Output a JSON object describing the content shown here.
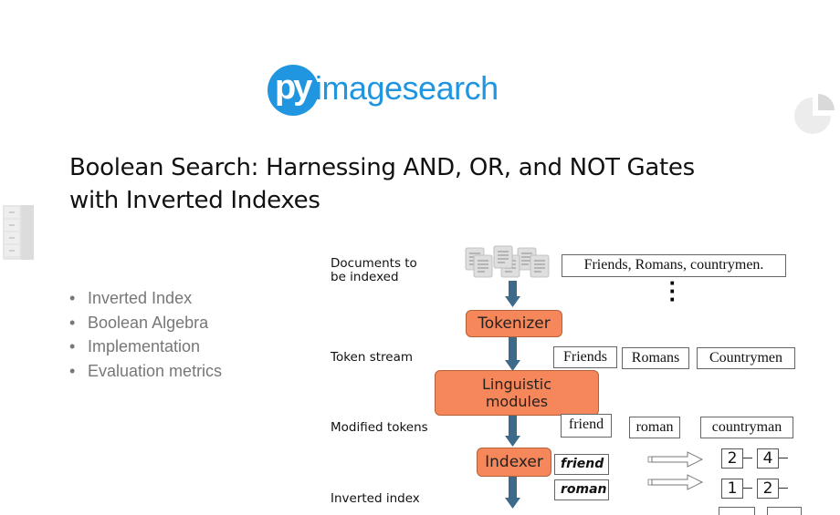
{
  "brand": {
    "logo_mark": "py",
    "logo_word": "imagesearch",
    "color": "#2196e0"
  },
  "icons": {
    "pie": "pie-chart-icon",
    "drawer": "file-cabinet-icon"
  },
  "title": {
    "line1": "Boolean Search: Harnessing AND, OR, and NOT Gates",
    "line2": "with Inverted Indexes"
  },
  "bullets": [
    "Inverted Index",
    "Boolean Algebra",
    "Implementation",
    "Evaluation metrics"
  ],
  "diagram": {
    "stage_labels": {
      "documents_line1": "Documents to",
      "documents_line2": "be indexed",
      "token_stream": "Token stream",
      "modified_tokens": "Modified tokens",
      "inverted_index": "Inverted index"
    },
    "modules": {
      "tokenizer": "Tokenizer",
      "linguistic_line1": "Linguistic",
      "linguistic_line2": "modules",
      "indexer": "Indexer"
    },
    "document_text": "Friends, Romans, countrymen.",
    "ellipsis": "⋮",
    "tokens": [
      "Friends",
      "Romans",
      "Countrymen"
    ],
    "modified_tokens": [
      "friend",
      "roman",
      "countryman"
    ],
    "index_terms": [
      "friend",
      "roman"
    ],
    "postings": [
      [
        "2",
        "4"
      ],
      [
        "1",
        "2"
      ]
    ],
    "colors": {
      "module_fill": "#f6875a",
      "arrow": "#3d6a89"
    }
  }
}
